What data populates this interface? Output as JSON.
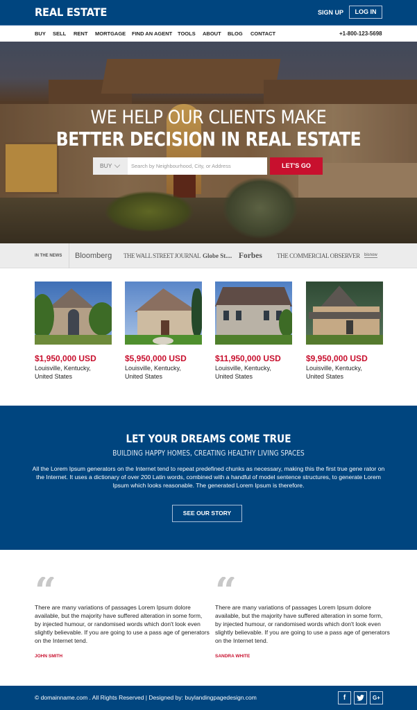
{
  "header": {
    "logo": "REAL ESTATE",
    "signup_label": "SIGN UP",
    "login_label": "LOG IN"
  },
  "nav": {
    "items": [
      {
        "label": "BUY"
      },
      {
        "label": "SELL"
      },
      {
        "label": "RENT"
      },
      {
        "label": "MORTGAGE"
      },
      {
        "label": "FIND AN AGENT"
      },
      {
        "label": "TOOLS"
      },
      {
        "label": "ABOUT"
      },
      {
        "label": "BLOG"
      },
      {
        "label": "CONTACT"
      }
    ],
    "phone": "+1-800-123-5698"
  },
  "hero": {
    "line1": "WE HELP OUR CLIENTS MAKE",
    "line2": "BETTER DECISION IN REAL ESTATE",
    "search": {
      "type_selected": "BUY",
      "placeholder": "Search by Neighbourhood, City, or Address",
      "value": "",
      "button_label": "LET'S GO"
    }
  },
  "news": {
    "label": "IN THE NEWS",
    "logos": [
      "Bloomberg",
      "THE WALL STREET JOURNAL",
      "Globe St....",
      "Forbes",
      "THE COMMERCIAL OBSERVER",
      "bisnow"
    ]
  },
  "listings": [
    {
      "price": "$1,950,000 USD",
      "location_line1": "Louisville, Kentucky,",
      "location_line2": "United States"
    },
    {
      "price": "$5,950,000 USD",
      "location_line1": "Louisville, Kentucky,",
      "location_line2": "United States"
    },
    {
      "price": "$11,950,000 USD",
      "location_line1": "Louisville, Kentucky,",
      "location_line2": "United States"
    },
    {
      "price": "$9,950,000 USD",
      "location_line1": "Louisville, Kentucky,",
      "location_line2": "United States"
    }
  ],
  "dreams": {
    "title": "LET YOUR DREAMS COME TRUE",
    "subtitle": "BUILDING HAPPY HOMES, CREATING HEALTHY LIVING SPACES",
    "body": "All the Lorem Ipsum generators on the Internet tend to repeat predefined chunks as necessary, making this the first true gene rator on the Internet. It uses a dictionary of over 200 Latin words, combined with a handful of model sentence structures, to generate Lorem Ipsum which looks reasonable. The generated Lorem Ipsum is therefore.",
    "button_label": "SEE OUR STORY"
  },
  "testimonials": [
    {
      "quote_icon": "“",
      "text": "There are many variations of passages Lorem Ipsum dolore available, but the majority have suffered alteration in some form, by injected humour, or randomised words which don't look even slightly believable. If you are going to use a pass age of generators on the Internet tend.",
      "name": "JOHN SMITH"
    },
    {
      "quote_icon": "“",
      "text": "There are many variations of passages Lorem Ipsum dolore available, but the majority have suffered alteration in some form, by injected humour, or randomised words which don't look even slightly believable. If you are going to use a pass age of generators on the Internet tend.",
      "name": "SANDRA WHITE"
    }
  ],
  "footer": {
    "copyright": "© domainname.com . All Rights Reserved | Designed by: buylandingpagedesign.com",
    "social": [
      {
        "icon": "facebook-icon",
        "glyph": "f"
      },
      {
        "icon": "twitter-icon",
        "glyph": "🐦"
      },
      {
        "icon": "google-plus-icon",
        "glyph": "G+"
      }
    ]
  },
  "colors": {
    "brand_blue": "#00457f",
    "accent_red": "#c8102e",
    "news_bg": "#ececec"
  }
}
